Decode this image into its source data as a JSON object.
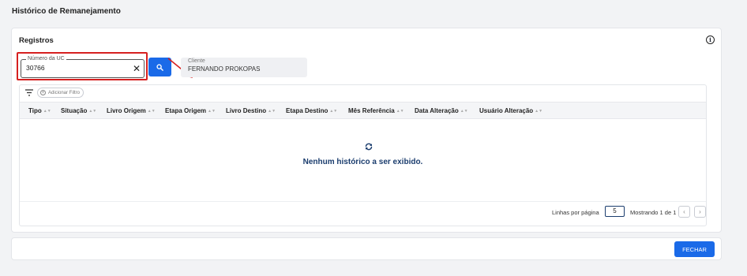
{
  "page": {
    "title": "Histórico de Remanejamento"
  },
  "registros": {
    "title": "Registros",
    "uc_field": {
      "label": "Número da UC",
      "value": "30766"
    },
    "client": {
      "label": "Cliente",
      "value": "FERNANDO PROKOPAS"
    }
  },
  "table": {
    "add_filter_label": "Adicionar Filtro",
    "columns": [
      "Tipo",
      "Situação",
      "Livro Origem",
      "Etapa Origem",
      "Livro Destino",
      "Etapa Destino",
      "Mês Referência",
      "Data Alteração",
      "Usuário Alteração"
    ],
    "empty_message": "Nenhum histórico a ser exibido.",
    "pagination": {
      "rows_label": "Linhas por página",
      "rows_value": "5",
      "showing": "Mostrando 1 de 1"
    }
  },
  "footer": {
    "close_label": "FECHAR"
  },
  "colors": {
    "primary": "#1a6ae8",
    "highlight": "#d62020",
    "empty_text": "#1b3d6e"
  }
}
